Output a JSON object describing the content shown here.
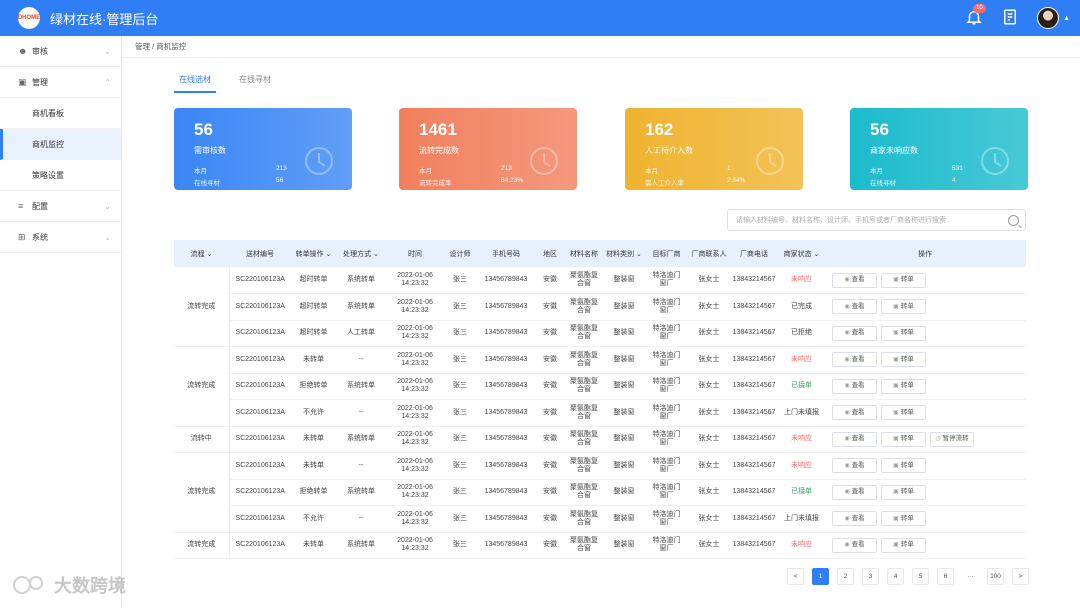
{
  "topbar": {
    "logo_text": "DHOME",
    "title": "绿材在线·管理后台",
    "bell_badge": "10"
  },
  "sidebar": {
    "groups": [
      {
        "label": "审核",
        "icon": "user-icon"
      },
      {
        "label": "管理",
        "icon": "folder-icon",
        "items": [
          "商机看板",
          "商机监控",
          "策略设置"
        ]
      },
      {
        "label": "配置",
        "icon": "sliders-icon"
      },
      {
        "label": "系统",
        "icon": "grid-icon"
      }
    ]
  },
  "breadcrumb": "管理 / 商机监控",
  "tabs": [
    "在线选材",
    "在线寻材"
  ],
  "cards": [
    {
      "num": "56",
      "label": "需审核数",
      "r1k": "本月",
      "r1v": "213",
      "r2k": "在线寻材",
      "r2v": "56",
      "color": "#3a86f5"
    },
    {
      "num": "1461",
      "label": "流转完成数",
      "r1k": "本月",
      "r1v": "213",
      "r2k": "流转完成率",
      "r2v": "84.23%",
      "color": "#f17f5d"
    },
    {
      "num": "162",
      "label": "人工待介入数",
      "r1k": "本月",
      "r1v": "1",
      "r2k": "需人工介入率",
      "r2v": "2.34%",
      "color": "#efb32e"
    },
    {
      "num": "56",
      "label": "商家未响应数",
      "r1k": "本月",
      "r1v": "531",
      "r2k": "在线寻材",
      "r2v": "4",
      "color": "#1bbbcc"
    }
  ],
  "search": {
    "placeholder": "请输入材料编号、材料名称、设计师、手机号或者厂商名称进行搜索"
  },
  "table": {
    "headers": [
      "流程",
      "送材编号",
      "转单操作",
      "处理方式",
      "时间",
      "设计师",
      "手机号码",
      "地区",
      "材料名称",
      "材料类别",
      "目标厂商",
      "厂商联系人",
      "厂商电话",
      "商家状态",
      "操作"
    ],
    "rows": [
      {
        "flow": "流转完成",
        "span": 3,
        "no": "SC220106123A",
        "op": "超时转单",
        "mode": "系统转单",
        "date": "2022-01-06",
        "time": "14:23:32",
        "designer": "张三",
        "phone": "13456789843",
        "region": "安徽",
        "material": "聚氨酯复合窗",
        "cat": "整装窗",
        "vendor": "特洛迪门窗厂",
        "contact": "张女士",
        "vphone": "13843214567",
        "status": "未响应",
        "stc": "red",
        "pause": false
      },
      {
        "no": "SC220106123A",
        "op": "超时转单",
        "mode": "系统转单",
        "date": "2022-01-06",
        "time": "14:23:32",
        "designer": "张三",
        "phone": "13456789843",
        "region": "安徽",
        "material": "聚氨酯复合窗",
        "cat": "整装窗",
        "vendor": "特洛迪门窗厂",
        "contact": "张女士",
        "vphone": "13843214567",
        "status": "已完成",
        "stc": "",
        "pause": false
      },
      {
        "no": "SC220106123A",
        "op": "超时转单",
        "mode": "人工转单",
        "date": "2022-01-06",
        "time": "14:23:32",
        "designer": "张三",
        "phone": "13456789843",
        "region": "安徽",
        "material": "聚氨酯复合窗",
        "cat": "整装窗",
        "vendor": "特洛迪门窗厂",
        "contact": "张女士",
        "vphone": "13843214567",
        "status": "已拒绝",
        "stc": "",
        "pause": false
      },
      {
        "flow": "流转完成",
        "span": 3,
        "no": "SC220106123A",
        "op": "未转单",
        "mode": "--",
        "date": "2022-01-06",
        "time": "14:23:32",
        "designer": "张三",
        "phone": "13456789843",
        "region": "安徽",
        "material": "聚氨酯复合窗",
        "cat": "整装窗",
        "vendor": "特洛迪门窗厂",
        "contact": "张女士",
        "vphone": "13843214567",
        "status": "未响应",
        "stc": "red",
        "pause": false
      },
      {
        "no": "SC220106123A",
        "op": "拒绝转单",
        "mode": "系统转单",
        "date": "2022-01-06",
        "time": "14:23:32",
        "designer": "张三",
        "phone": "13456789843",
        "region": "安徽",
        "material": "聚氨酯复合窗",
        "cat": "整装窗",
        "vendor": "特洛迪门窗厂",
        "contact": "张女士",
        "vphone": "13843214567",
        "status": "已接单",
        "stc": "green",
        "pause": false
      },
      {
        "no": "SC220106123A",
        "op": "不允许",
        "mode": "--",
        "date": "2022-01-06",
        "time": "14:23:32",
        "designer": "张三",
        "phone": "13456789843",
        "region": "安徽",
        "material": "聚氨酯复合窗",
        "cat": "整装窗",
        "vendor": "特洛迪门窗厂",
        "contact": "张女士",
        "vphone": "13843214567",
        "status": "上门未填报",
        "stc": "",
        "pause": false
      },
      {
        "flow": "流转中",
        "span": 1,
        "no": "SC220106123A",
        "op": "未转单",
        "mode": "系统转单",
        "date": "2022-01-06",
        "time": "14:23:32",
        "designer": "张三",
        "phone": "13456789843",
        "region": "安徽",
        "material": "聚氨酯复合窗",
        "cat": "整装窗",
        "vendor": "特洛迪门窗厂",
        "contact": "张女士",
        "vphone": "13843214567",
        "status": "未响应",
        "stc": "red",
        "pause": true
      },
      {
        "flow": "流转完成",
        "span": 3,
        "no": "SC220106123A",
        "op": "未转单",
        "mode": "--",
        "date": "2022-01-06",
        "time": "14:23:32",
        "designer": "张三",
        "phone": "13456789843",
        "region": "安徽",
        "material": "聚氨酯复合窗",
        "cat": "整装窗",
        "vendor": "特洛迪门窗厂",
        "contact": "张女士",
        "vphone": "13843214567",
        "status": "未响应",
        "stc": "red",
        "pause": false
      },
      {
        "no": "SC220106123A",
        "op": "拒绝转单",
        "mode": "系统转单",
        "date": "2022-01-06",
        "time": "14:23:32",
        "designer": "张三",
        "phone": "13456789843",
        "region": "安徽",
        "material": "聚氨酯复合窗",
        "cat": "整装窗",
        "vendor": "特洛迪门窗厂",
        "contact": "张女士",
        "vphone": "13843214567",
        "status": "已接单",
        "stc": "green",
        "pause": false
      },
      {
        "no": "SC220106123A",
        "op": "不允许",
        "mode": "--",
        "date": "2022-01-06",
        "time": "14:23:32",
        "designer": "张三",
        "phone": "13456789843",
        "region": "安徽",
        "material": "聚氨酯复合窗",
        "cat": "整装窗",
        "vendor": "特洛迪门窗厂",
        "contact": "张女士",
        "vphone": "13843214567",
        "status": "上门未填报",
        "stc": "",
        "pause": false
      },
      {
        "flow": "流转完成",
        "span": 1,
        "no": "SC220106123A",
        "op": "未转单",
        "mode": "系统转单",
        "date": "2022-01-06",
        "time": "14:23:32",
        "designer": "张三",
        "phone": "13456789843",
        "region": "安徽",
        "material": "聚氨酯复合窗",
        "cat": "整装窗",
        "vendor": "特洛迪门窗厂",
        "contact": "张女士",
        "vphone": "13843214567",
        "status": "未响应",
        "stc": "red",
        "pause": false
      }
    ],
    "btn_view": "查看",
    "btn_turn": "转单",
    "btn_pause": "暂停流转"
  },
  "pager": [
    "<",
    "1",
    "2",
    "3",
    "4",
    "5",
    "6",
    "···",
    "100",
    ">"
  ],
  "pager_active": "1",
  "watermark": "大数跨境"
}
